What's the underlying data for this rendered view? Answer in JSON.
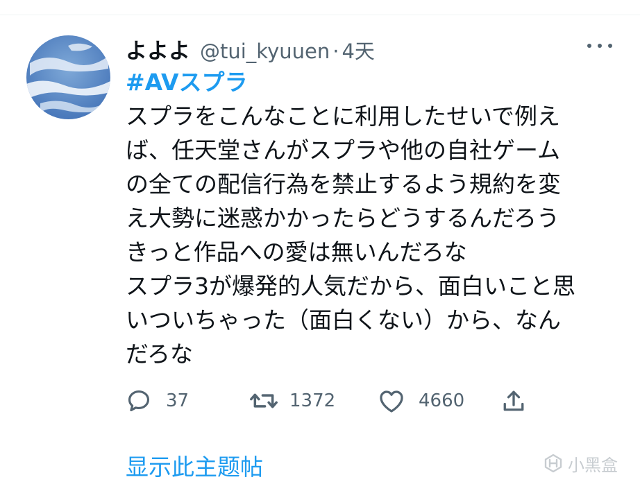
{
  "tweet": {
    "display_name": "よよよ",
    "handle": "@tui_kyuuen",
    "separator": "·",
    "time": "4天",
    "hashtag": "#AVスプラ",
    "body_lines": [
      "スプラをこんなことに利用したせいで例え",
      "ば、任天堂さんがスプラや他の自社ゲーム",
      "の全ての配信行為を禁止するよう規約を変",
      "え大勢に迷惑かかったらどうするんだろう",
      "きっと作品への愛は無いんだろな",
      "スプラ3が爆発的人気だから、面白いこと思",
      "いついちゃった（面白くない）から、なん",
      "だろな"
    ],
    "actions": {
      "reply_count": "37",
      "retweet_count": "1372",
      "like_count": "4660"
    },
    "show_thread": "显示此主题帖"
  },
  "watermark": {
    "text": "小黑盒",
    "icon": "heybox-logo-icon"
  },
  "icons": [
    "reply-icon",
    "retweet-icon",
    "like-icon",
    "share-icon",
    "more-icon"
  ],
  "colors": {
    "accent": "#1d9bf0",
    "text": "#0f1419",
    "secondary": "#536471"
  }
}
